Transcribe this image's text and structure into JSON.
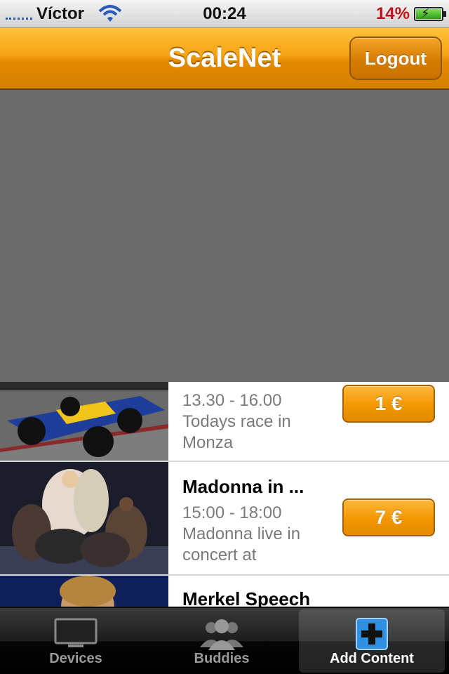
{
  "status_bar": {
    "carrier": "Víctor",
    "time": "00:24",
    "battery": "14%"
  },
  "nav": {
    "title": "ScaleNet",
    "logout_label": "Logout"
  },
  "list": {
    "items": [
      {
        "title": "",
        "time": "13.30 - 16.00",
        "desc_line1": "Todays race in",
        "desc_line2": "Monza",
        "price": "1 €"
      },
      {
        "title": "Madonna in ...",
        "time": "15:00 - 18:00",
        "desc_line1": "Madonna live in",
        "desc_line2": "concert at",
        "price": "7 €"
      },
      {
        "title": "Merkel Speech"
      }
    ]
  },
  "tabs": [
    {
      "label": "Devices",
      "icon": "monitor-icon"
    },
    {
      "label": "Buddies",
      "icon": "people-icon"
    },
    {
      "label": "Add Content",
      "icon": "add-content-icon",
      "selected": true
    }
  ],
  "colors": {
    "accent": "#f29700",
    "battery_low": "#c0101a",
    "tab_selected": "#ffffff"
  }
}
